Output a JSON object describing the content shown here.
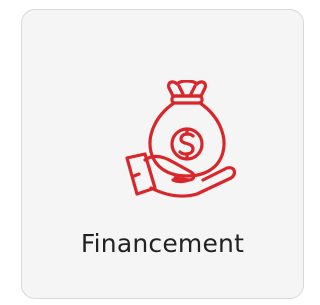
{
  "tile": {
    "label": "Financement",
    "icon": "money-bag-in-hand-icon",
    "accent_color": "#d8262a"
  }
}
